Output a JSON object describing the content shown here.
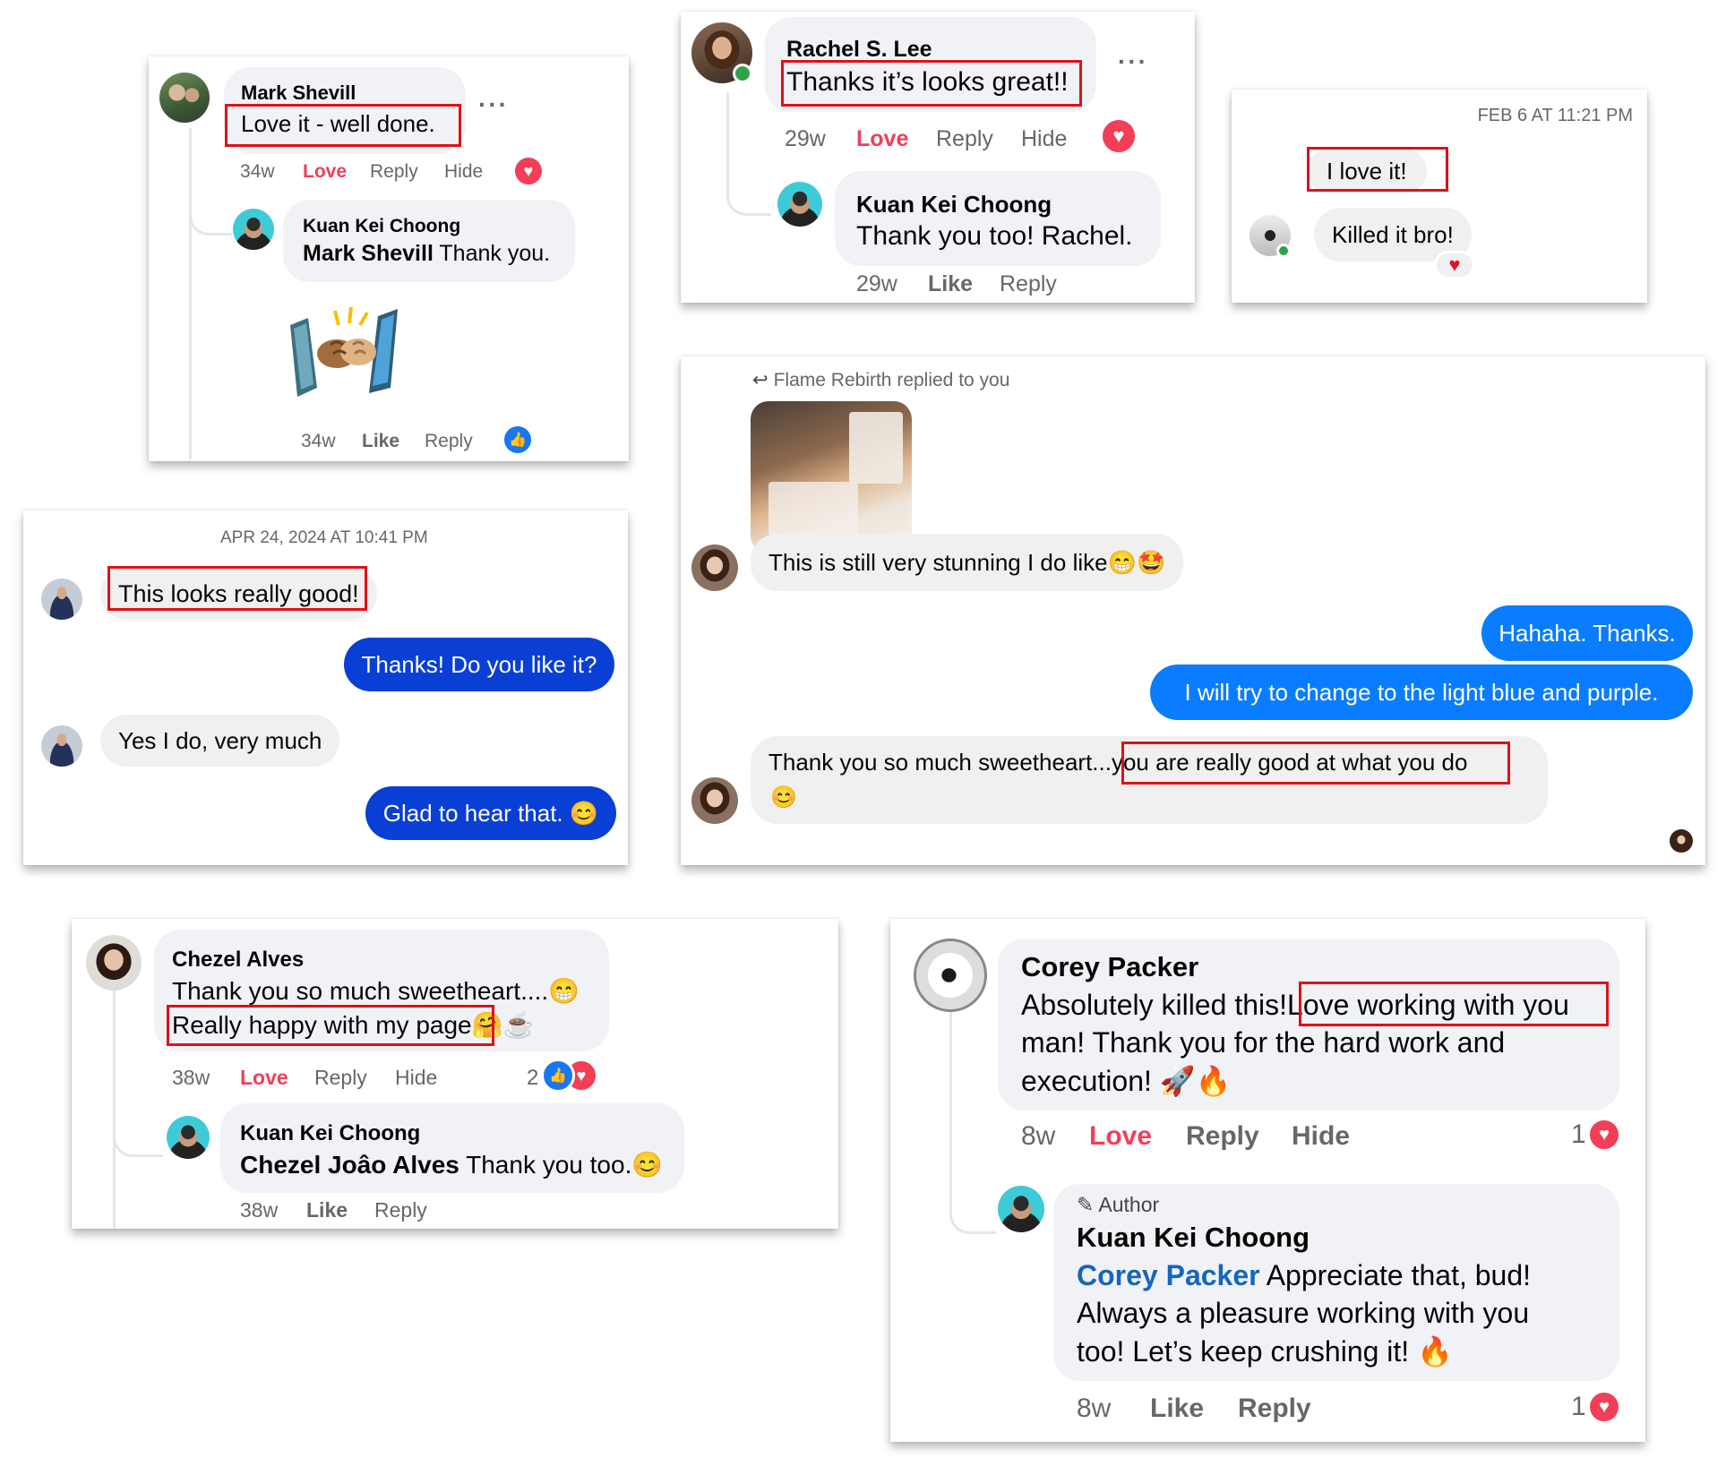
{
  "card_mark": {
    "name": "Mark Shevill",
    "comment": "Love it - well done.",
    "time": "34w",
    "love": "Love",
    "reply": "Reply",
    "hide": "Hide",
    "reply_name": "Kuan Kei Choong",
    "reply_mention": "Mark Shevill",
    "reply_text": "Thank you.",
    "reply_time": "34w",
    "reply_like": "Like",
    "reply_reply": "Reply"
  },
  "card_rachel": {
    "name": "Rachel S. Lee",
    "comment": "Thanks it’s looks great!!",
    "time": "29w",
    "love": "Love",
    "reply": "Reply",
    "hide": "Hide",
    "reply_name": "Kuan Kei Choong",
    "reply_text": "Thank you too! Rachel.",
    "reply_time": "29w",
    "reply_like": "Like",
    "reply_reply": "Reply"
  },
  "card_feb": {
    "timestamp": "FEB 6 AT 11:21 PM",
    "msg1": "I love it!",
    "msg2": "Killed it bro!"
  },
  "card_apr": {
    "timestamp": "APR 24, 2024 AT 10:41 PM",
    "msg1": "This looks really good!",
    "msg2": "Thanks! Do you like it?",
    "msg3": "Yes I do, very much",
    "msg4": "Glad to hear that. 😊"
  },
  "card_flame": {
    "header": "Flame Rebirth replied to you",
    "msg1": "This is still very stunning I do like😁🤩",
    "msg2": "Hahaha. Thanks.",
    "msg3": "I will try to change to the light blue and purple.",
    "msg4_a": "Thank you so much sweetheart...",
    "msg4_b": "you are really good at what you do",
    "msg4_emoji": "😊"
  },
  "card_chezel": {
    "name": "Chezel Alves",
    "line1": "Thank you so much sweetheart....😁",
    "line2": "Really happy with my page",
    "line2_emoji": "🤗☕",
    "time": "38w",
    "love": "Love",
    "reply": "Reply",
    "hide": "Hide",
    "react_count": "2",
    "reply_name": "Kuan Kei Choong",
    "reply_mention": "Chezel Joâo Alves",
    "reply_text": "Thank you too.😊",
    "reply_time": "38w",
    "reply_like": "Like",
    "reply_reply": "Reply"
  },
  "card_corey": {
    "name": "Corey Packer",
    "line1_a": "Absolutely killed this!",
    "line1_b": "Love working with you",
    "line2": "man! Thank you for the hard work and",
    "line3": "execution! 🚀🔥",
    "time": "8w",
    "love": "Love",
    "reply": "Reply",
    "hide": "Hide",
    "react_count": "1",
    "author_badge": "Author",
    "reply_name": "Kuan Kei Choong",
    "reply_mention": "Corey Packer",
    "reply_line1": "Appreciate that, bud!",
    "reply_line2": "Always a pleasure working with you",
    "reply_line3": "too! Let’s keep crushing it! 🔥",
    "reply_time": "8w",
    "reply_like": "Like",
    "reply_reply": "Reply",
    "reply_react_count": "1"
  },
  "colors": {
    "highlight": "#e01018",
    "love": "#f33e58",
    "messenger_blue": "#0a3fd6",
    "messenger_light_blue": "#0a7cff",
    "link_blue": "#1565c0",
    "bubble_gray": "#f0f2f5"
  },
  "icons": [
    "more-dots-icon",
    "heart-reaction-icon",
    "like-reaction-icon",
    "reply-arrow-icon",
    "pencil-icon",
    "fist-bump-sticker"
  ]
}
